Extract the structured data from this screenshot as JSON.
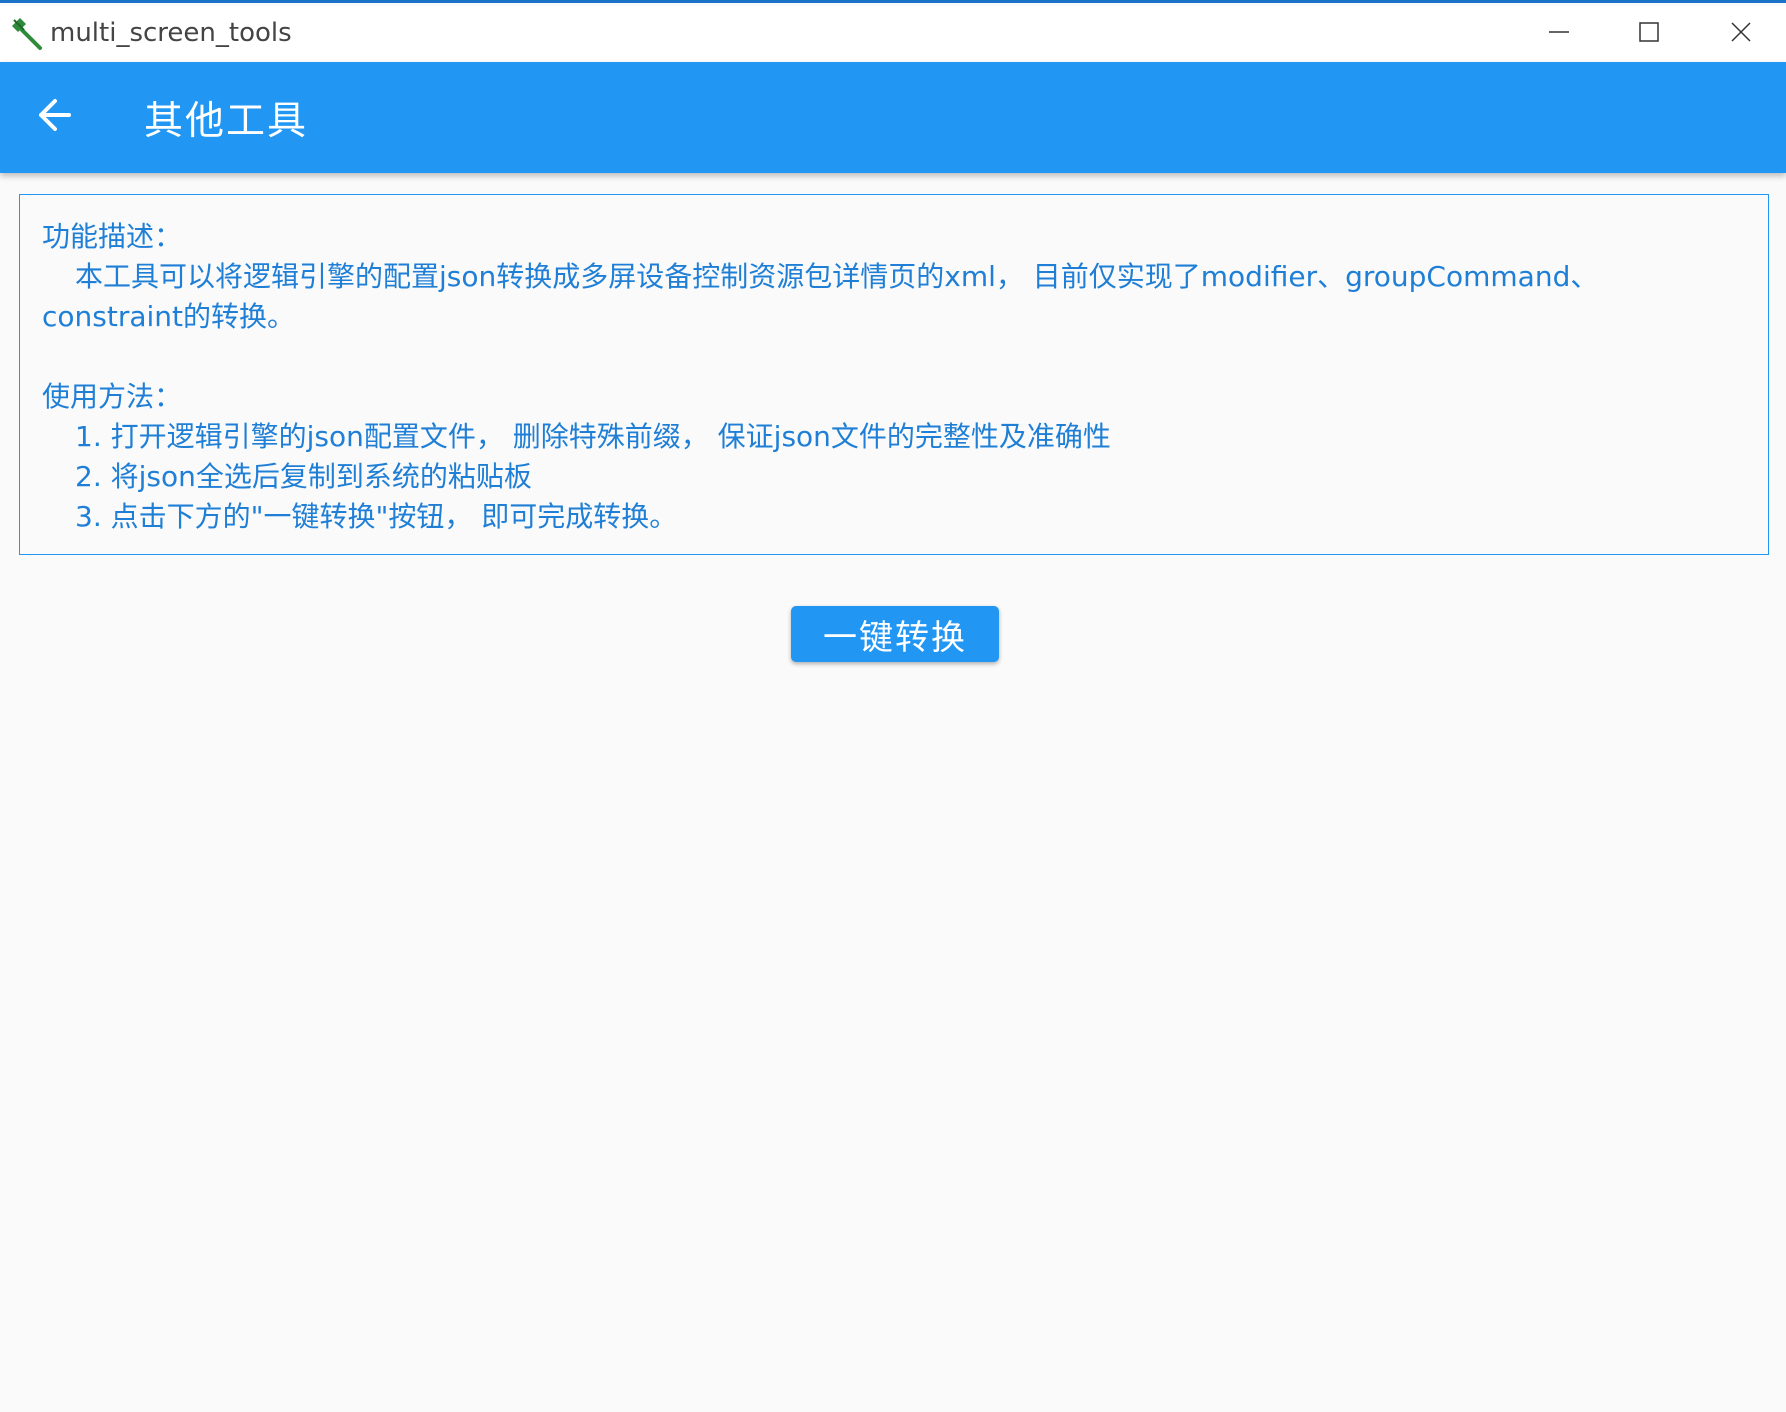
{
  "window": {
    "title": "multi_screen_tools",
    "icon": "hammer-icon",
    "controls": [
      "minimize-icon",
      "maximize-icon",
      "close-icon"
    ]
  },
  "appbar": {
    "back_icon": "arrow-back-icon",
    "title": "其他工具",
    "color": "#2196f3"
  },
  "description": {
    "heading_function": "功能描述：",
    "function_text_line1": "本工具可以将逻辑引擎的配置json转换成多屏设备控制资源包详情页的xml， 目前仅实现了modifier、groupCommand、",
    "function_text_line2": "constraint的转换。",
    "heading_usage": "使用方法：",
    "steps": [
      "1. 打开逻辑引擎的json配置文件， 删除特殊前缀， 保证json文件的完整性及准确性",
      "2. 将json全选后复制到系统的粘贴板",
      "3. 点击下方的\"一键转换\"按钮， 即可完成转换。"
    ],
    "text_color": "#1f7fd6"
  },
  "actions": {
    "convert_label": "一键转换"
  }
}
